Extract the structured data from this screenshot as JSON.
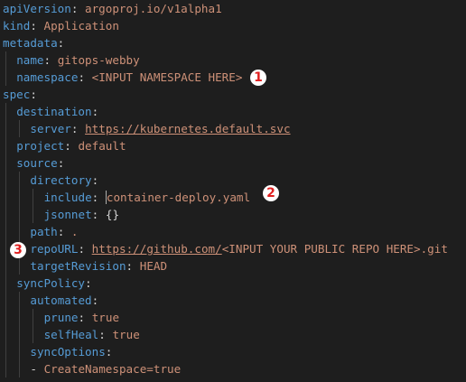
{
  "colors": {
    "background": "#1e1e1e",
    "key": "#569cd6",
    "value": "#ce9178",
    "punctuation": "#d4d4d4",
    "badge_bg": "#ffffff",
    "badge_text": "#e02020"
  },
  "lines": [
    {
      "indent": 0,
      "key": "apiVersion",
      "value": "argoproj.io/v1alpha1"
    },
    {
      "indent": 0,
      "key": "kind",
      "value": "Application"
    },
    {
      "indent": 0,
      "key": "metadata",
      "value": ""
    },
    {
      "indent": 1,
      "key": "name",
      "value": "gitops-webby"
    },
    {
      "indent": 1,
      "key": "namespace",
      "value": "<INPUT NAMESPACE HERE>"
    },
    {
      "indent": 0,
      "key": "spec",
      "value": ""
    },
    {
      "indent": 1,
      "key": "destination",
      "value": ""
    },
    {
      "indent": 2,
      "key": "server",
      "value": "https://kubernetes.default.svc"
    },
    {
      "indent": 1,
      "key": "project",
      "value": "default"
    },
    {
      "indent": 1,
      "key": "source",
      "value": ""
    },
    {
      "indent": 2,
      "key": "directory",
      "value": ""
    },
    {
      "indent": 3,
      "key": "include",
      "value": "container-deploy.yaml"
    },
    {
      "indent": 3,
      "key": "jsonnet",
      "value": "{}"
    },
    {
      "indent": 2,
      "key": "path",
      "value": "."
    },
    {
      "indent": 2,
      "key": "repoURL",
      "value": "https://github.com/",
      "value_suffix": "<INPUT YOUR PUBLIC REPO HERE>.git"
    },
    {
      "indent": 2,
      "key": "targetRevision",
      "value": "HEAD"
    },
    {
      "indent": 1,
      "key": "syncPolicy",
      "value": ""
    },
    {
      "indent": 2,
      "key": "automated",
      "value": ""
    },
    {
      "indent": 3,
      "key": "prune",
      "value": "true"
    },
    {
      "indent": 3,
      "key": "selfHeal",
      "value": "true"
    },
    {
      "indent": 2,
      "key": "syncOptions",
      "value": ""
    },
    {
      "indent": 2,
      "key": "",
      "value": "CreateNamespace=true",
      "list_item": true
    }
  ],
  "annotations": [
    {
      "label": "1"
    },
    {
      "label": "2"
    },
    {
      "label": "3"
    }
  ]
}
